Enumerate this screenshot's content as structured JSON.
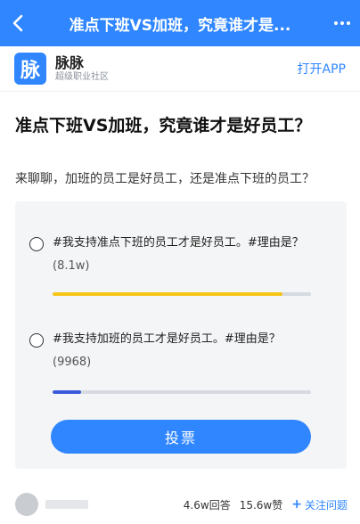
{
  "topbar": {
    "title": "准点下班VS加班，究竟谁才是...",
    "back_icon": "chevron-left-icon",
    "more_icon": "more-dots-icon"
  },
  "app": {
    "logo_char": "脉",
    "name": "脉脉",
    "slogan": "超级职业社区",
    "open_label": "打开APP"
  },
  "question": {
    "title": "准点下班VS加班，究竟谁才是好员工？",
    "description": "来聊聊，加班的员工是好员工，还是准点下班的员工？"
  },
  "poll": {
    "options": [
      {
        "text": "#我支持准点下班的员工才是好员工。#理由是？",
        "count": "(8.1w)",
        "progress": 0.89,
        "color": "#f5c518"
      },
      {
        "text": "#我支持加班的员工才是好员工。#理由是？",
        "count": "(9968)",
        "progress": 0.11,
        "color": "#3b5bdb"
      }
    ],
    "vote_label": "投票"
  },
  "footer": {
    "answers": "4.6w回答",
    "likes": "15.6w赞",
    "follow_label": "关注问题"
  },
  "colors": {
    "brand": "#2f86ff",
    "poll_bg": "#f4f5f7"
  }
}
